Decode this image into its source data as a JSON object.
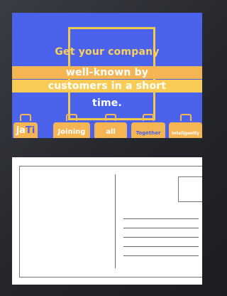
{
  "postcard_front": {
    "headline_lines": [
      "Get your company",
      "well-known by",
      "customers in a short",
      "time."
    ],
    "brand": {
      "prefix": "ja",
      "highlight": "Ti"
    },
    "words": [
      "Joining",
      "all",
      "Together",
      "Inteligently"
    ],
    "colors": {
      "background": "#4b63ec",
      "accent": "#f5b552",
      "frame": "#f0c84a",
      "headline_first": "#f8d25c",
      "text": "#ffffff"
    },
    "icon": "suitcase-icon"
  },
  "postcard_back": {
    "address_line_count": 5,
    "has_stamp_box": true
  }
}
